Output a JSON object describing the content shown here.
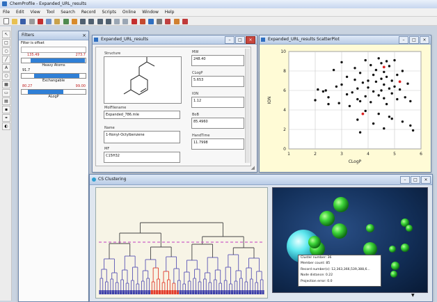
{
  "app": {
    "title": "ChemProfile - Expanded_URL_results",
    "menu": [
      "File",
      "Edit",
      "View",
      "Tool",
      "Search",
      "Record",
      "Scripts",
      "Online",
      "Window",
      "Help"
    ]
  },
  "filters_panel": {
    "title": "Filters",
    "header": "Filter is offset",
    "rows": [
      {
        "left": "135.49",
        "right": "273.7",
        "label": "Heavy Atoms",
        "fill": 0.85,
        "color": "#2f7fd6"
      },
      {
        "left": "91.7",
        "right": "",
        "label": "Exchangable",
        "fill": 0.7,
        "color": "#2f7fd6"
      },
      {
        "left": "80.27",
        "right": "99.00",
        "label": "ALogP",
        "fill": 0.55,
        "color": "#2f7fd6"
      }
    ]
  },
  "record_window": {
    "title": "Expanded_URL_results",
    "fields": [
      {
        "label": "Structure",
        "value": ""
      },
      {
        "label": "MolFilename",
        "value": "Expanded_786.mle"
      },
      {
        "label": "Name",
        "value": "1-Nonyl-Octylbenzene"
      },
      {
        "label": "MF",
        "value": "C15H32"
      },
      {
        "label": "MW",
        "value": "248.40"
      },
      {
        "label": "CLogP",
        "value": "5.653"
      },
      {
        "label": "ION",
        "value": "1.12"
      },
      {
        "label": "BoB",
        "value": "85.4960"
      },
      {
        "label": "HandTime",
        "value": "11.7998"
      }
    ]
  },
  "scatter_window": {
    "title": "Expanded_URL_results ScatterPlot"
  },
  "clustering_window": {
    "title": "CS Clustering",
    "tooltip": [
      "Cluster number: 36",
      "Member count: 85",
      "Record number(s): 12,363,366,539,388,6...",
      "Node distance: 0.22",
      "Projection error: 0.0"
    ]
  },
  "chart_data": {
    "type": "scatter",
    "xlabel": "CLogP",
    "ylabel": "ION",
    "xlim": [
      1,
      6
    ],
    "ylim": [
      0,
      10
    ],
    "xticks": [
      "1",
      "2",
      "3",
      "4",
      "5",
      "6"
    ],
    "yticks": [
      "0",
      "2",
      "4",
      "6",
      "8",
      "10"
    ],
    "points": [
      [
        2.0,
        5.0
      ],
      [
        2.1,
        6.1
      ],
      [
        2.3,
        5.9
      ],
      [
        2.4,
        6.0
      ],
      [
        2.5,
        4.6
      ],
      [
        2.5,
        5.3
      ],
      [
        2.7,
        8.1
      ],
      [
        2.8,
        6.4
      ],
      [
        2.9,
        4.7
      ],
      [
        3.0,
        8.9
      ],
      [
        3.0,
        6.6
      ],
      [
        3.2,
        7.4
      ],
      [
        3.2,
        5.6
      ],
      [
        3.3,
        4.4
      ],
      [
        3.4,
        5.8
      ],
      [
        3.5,
        7.1
      ],
      [
        3.5,
        8.3
      ],
      [
        3.6,
        6.2
      ],
      [
        3.6,
        5.1
      ],
      [
        3.7,
        4.9
      ],
      [
        3.7,
        7.8
      ],
      [
        3.8,
        6.8
      ],
      [
        3.9,
        5.4
      ],
      [
        3.9,
        9.1
      ],
      [
        4.0,
        7.0
      ],
      [
        4.0,
        6.3
      ],
      [
        4.1,
        8.6
      ],
      [
        4.1,
        4.8
      ],
      [
        4.2,
        5.9
      ],
      [
        4.2,
        7.6
      ],
      [
        4.3,
        6.9
      ],
      [
        4.3,
        8.1
      ],
      [
        4.4,
        5.5
      ],
      [
        4.4,
        9.3
      ],
      [
        4.5,
        7.2
      ],
      [
        4.5,
        6.0
      ],
      [
        4.5,
        8.8
      ],
      [
        4.6,
        5.2
      ],
      [
        4.6,
        7.9
      ],
      [
        4.6,
        6.6
      ],
      [
        4.7,
        9.0
      ],
      [
        4.7,
        4.6
      ],
      [
        4.7,
        7.4
      ],
      [
        4.8,
        6.2
      ],
      [
        4.8,
        8.5
      ],
      [
        4.9,
        5.7
      ],
      [
        4.9,
        7.0
      ],
      [
        5.0,
        6.4
      ],
      [
        5.0,
        9.1
      ],
      [
        5.1,
        5.1
      ],
      [
        5.1,
        7.6
      ],
      [
        5.2,
        6.1
      ],
      [
        5.3,
        8.0
      ],
      [
        5.4,
        5.3
      ],
      [
        5.5,
        6.7
      ],
      [
        5.6,
        4.9
      ],
      [
        5.6,
        2.4
      ],
      [
        5.7,
        1.9
      ],
      [
        3.6,
        3.0
      ],
      [
        3.7,
        1.7
      ],
      [
        4.2,
        2.6
      ],
      [
        4.6,
        2.1
      ],
      [
        4.9,
        3.1
      ],
      [
        5.3,
        2.8
      ],
      [
        3.9,
        3.9
      ],
      [
        4.4,
        3.6
      ],
      [
        4.8,
        3.3
      ]
    ],
    "highlighted": [
      [
        4.6,
        8.4
      ],
      [
        3.8,
        3.6
      ],
      [
        5.2,
        6.9
      ]
    ]
  }
}
